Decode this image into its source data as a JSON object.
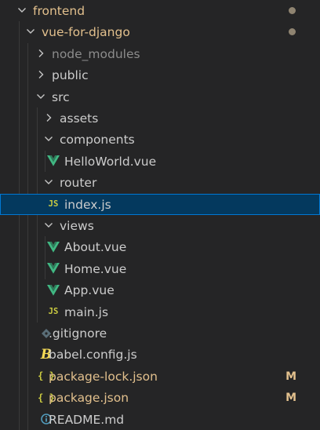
{
  "colors": {
    "background": "#252526",
    "selection": "#04395e",
    "text": "#cccccc",
    "muted_text": "#8c8c8c",
    "modified": "#e2c08d",
    "dot": "#8f8471",
    "vue_green": "#41b883",
    "js_yellow": "#cbcb41",
    "json_yellow": "#cbcb41",
    "babel_yellow": "#f5da55",
    "gitignore_gray": "#41535b",
    "info_blue": "#519aba"
  },
  "tree": {
    "items": [
      {
        "label": "frontend",
        "kind": "folder-open",
        "depth": 0,
        "color": "modified",
        "decoration": "dot"
      },
      {
        "label": "vue-for-django",
        "kind": "folder-open",
        "depth": 1,
        "color": "modified",
        "decoration": "dot"
      },
      {
        "label": "node_modules",
        "kind": "folder-closed",
        "depth": 2,
        "color": "muted_text"
      },
      {
        "label": "public",
        "kind": "folder-closed",
        "depth": 2,
        "color": "text"
      },
      {
        "label": "src",
        "kind": "folder-open",
        "depth": 2,
        "color": "text"
      },
      {
        "label": "assets",
        "kind": "folder-closed",
        "depth": 3,
        "color": "text"
      },
      {
        "label": "components",
        "kind": "folder-open",
        "depth": 3,
        "color": "text"
      },
      {
        "label": "HelloWorld.vue",
        "kind": "vue",
        "depth": 4,
        "color": "text"
      },
      {
        "label": "router",
        "kind": "folder-open",
        "depth": 3,
        "color": "text"
      },
      {
        "label": "index.js",
        "kind": "js",
        "depth": 4,
        "color": "text",
        "selected": true
      },
      {
        "label": "views",
        "kind": "folder-open",
        "depth": 3,
        "color": "text"
      },
      {
        "label": "About.vue",
        "kind": "vue",
        "depth": 4,
        "color": "text"
      },
      {
        "label": "Home.vue",
        "kind": "vue",
        "depth": 4,
        "color": "text"
      },
      {
        "label": "App.vue",
        "kind": "vue",
        "depth": 3,
        "color": "text"
      },
      {
        "label": "main.js",
        "kind": "js",
        "depth": 3,
        "color": "text"
      },
      {
        "label": ".gitignore",
        "kind": "gitignore",
        "depth": 2,
        "color": "text"
      },
      {
        "label": "babel.config.js",
        "kind": "babel",
        "depth": 2,
        "color": "text"
      },
      {
        "label": "package-lock.json",
        "kind": "json",
        "depth": 2,
        "color": "modified",
        "badge": "M"
      },
      {
        "label": "package.json",
        "kind": "json",
        "depth": 2,
        "color": "modified",
        "badge": "M"
      },
      {
        "label": "README.md",
        "kind": "info",
        "depth": 2,
        "color": "text"
      }
    ]
  },
  "icons": {
    "js_text": "JS",
    "json_text": "{ }",
    "babel_text": "B"
  }
}
